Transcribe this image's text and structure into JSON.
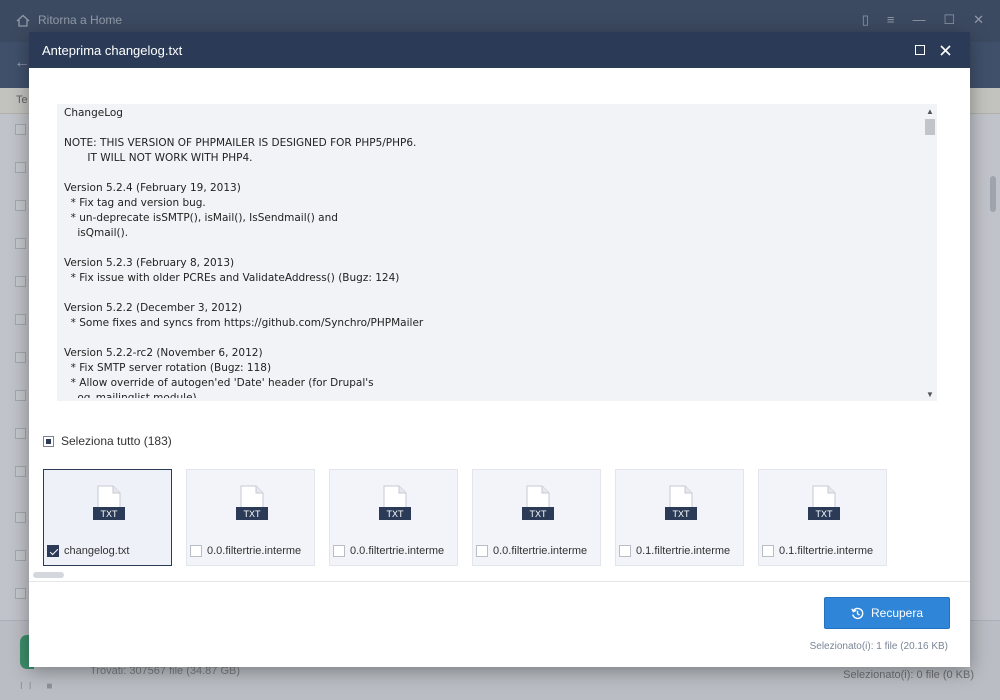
{
  "app": {
    "home_label": "Ritorna a Home",
    "toolbar_fragment": "Te",
    "found_text": "Trovati: 307567 file (34.87 GB)",
    "selected_text": "Selezionato(i): 0 file (0 KB)"
  },
  "dialog": {
    "title": "Anteprima changelog.txt",
    "preview_text": "ChangeLog\n\nNOTE: THIS VERSION OF PHPMAILER IS DESIGNED FOR PHP5/PHP6.\n       IT WILL NOT WORK WITH PHP4.\n\nVersion 5.2.4 (February 19, 2013)\n  * Fix tag and version bug.\n  * un-deprecate isSMTP(), isMail(), IsSendmail() and\n    isQmail().\n\nVersion 5.2.3 (February 8, 2013)\n  * Fix issue with older PCREs and ValidateAddress() (Bugz: 124)\n\nVersion 5.2.2 (December 3, 2012)\n  * Some fixes and syncs from https://github.com/Synchro/PHPMailer\n\nVersion 5.2.2-rc2 (November 6, 2012)\n  * Fix SMTP server rotation (Bugz: 118)\n  * Allow override of autogen'ed 'Date' header (for Drupal's\n    og_mailinglist module)",
    "select_all_label": "Seleziona tutto (183)",
    "file_badge": "TXT",
    "files": [
      {
        "name": "changelog.txt",
        "checked": true
      },
      {
        "name": "0.0.filtertrie.interme",
        "checked": false
      },
      {
        "name": "0.0.filtertrie.interme",
        "checked": false
      },
      {
        "name": "0.0.filtertrie.interme",
        "checked": false
      },
      {
        "name": "0.1.filtertrie.interme",
        "checked": false
      },
      {
        "name": "0.1.filtertrie.interme",
        "checked": false
      }
    ],
    "recover_label": "Recupera",
    "selected_info": "Selezionato(i): 1 file (20.16 KB)"
  },
  "colors": {
    "header": "#2b3b57",
    "accent": "#2f86d8"
  },
  "icons": {
    "home": "home-icon",
    "maximize": "maximize-icon",
    "close": "close-icon",
    "file": "txt-file-icon",
    "recover": "recover-icon"
  }
}
